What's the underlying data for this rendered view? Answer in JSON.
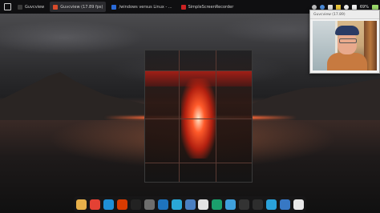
{
  "top_panel": {
    "tasks": [
      {
        "label": "Guvcview",
        "active": false,
        "icon": "terminal-icon",
        "color": "#3a3a3a"
      },
      {
        "label": "Guvcview (17.89 fps)",
        "active": true,
        "icon": "webcam-icon",
        "color": "#d84a2a"
      },
      {
        "label": "/windows versus Linux - ...",
        "active": false,
        "icon": "browser-icon",
        "color": "#2a6ad8"
      },
      {
        "label": "SimpleScreenRecorder",
        "active": false,
        "icon": "recorder-icon",
        "color": "#c22"
      }
    ],
    "tray": {
      "battery": "69%",
      "icons": [
        "chat-icon",
        "bluetooth-icon",
        "lock-icon",
        "warning-icon",
        "wifi-icon",
        "volume-icon",
        "battery-icon"
      ]
    }
  },
  "cam_window": {
    "title": "Guvcview (17.89)"
  },
  "dock": {
    "items": [
      {
        "name": "files-icon",
        "color": "#e8b04a",
        "glyph": ""
      },
      {
        "name": "chrome-icon",
        "color": "#e44134",
        "glyph": ""
      },
      {
        "name": "edge-icon",
        "color": "#1f8fd6",
        "glyph": ""
      },
      {
        "name": "office-icon",
        "color": "#d83b01",
        "glyph": ""
      },
      {
        "name": "camera-icon",
        "color": "#222222",
        "glyph": ""
      },
      {
        "name": "calculator-icon",
        "color": "#6d6d6d",
        "glyph": ""
      },
      {
        "name": "writer-icon",
        "color": "#1e73be",
        "glyph": ""
      },
      {
        "name": "monitor-icon",
        "color": "#2aa7d6",
        "glyph": ""
      },
      {
        "name": "virtualbox-icon",
        "color": "#4a7fc1",
        "glyph": ""
      },
      {
        "name": "settings-icon",
        "color": "#e3e3e3",
        "glyph": ""
      },
      {
        "name": "web-icon",
        "color": "#1b9f6c",
        "glyph": ""
      },
      {
        "name": "vm-icon",
        "color": "#3fa0dc",
        "glyph": ""
      },
      {
        "name": "clapper-icon",
        "color": "#333333",
        "glyph": ""
      },
      {
        "name": "terminal-icon",
        "color": "#2d2d2d",
        "glyph": ""
      },
      {
        "name": "telegram-icon",
        "color": "#2aa1da",
        "glyph": ""
      },
      {
        "name": "store-icon",
        "color": "#3778c4",
        "glyph": ""
      },
      {
        "name": "notes-icon",
        "color": "#e9e9e9",
        "glyph": ""
      }
    ]
  }
}
